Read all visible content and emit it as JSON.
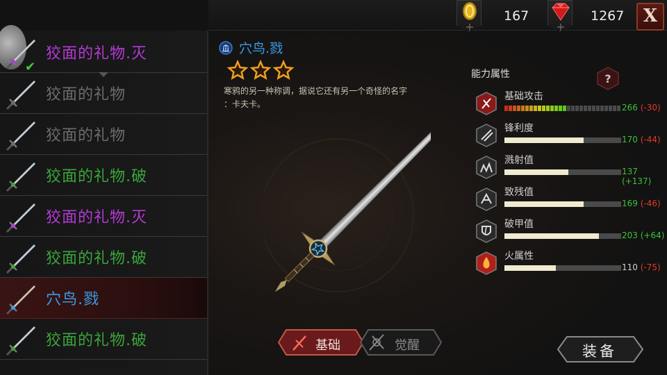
{
  "currency": {
    "gold": {
      "icon": "gold-coin-icon",
      "value": "167"
    },
    "gems": {
      "icon": "ruby-gem-icon",
      "value": "1267"
    },
    "close_label": "X"
  },
  "weapon_list": [
    {
      "name": "狡面的礼物.灭",
      "color": "#b43ad6",
      "state": "equipped"
    },
    {
      "name": "狡面的礼物",
      "color": "#6c6c6c",
      "state": "normal"
    },
    {
      "name": "狡面的礼物",
      "color": "#6c6c6c",
      "state": "normal"
    },
    {
      "name": "狡面的礼物.破",
      "color": "#3aa63a",
      "state": "normal"
    },
    {
      "name": "狡面的礼物.灭",
      "color": "#b43ad6",
      "state": "normal"
    },
    {
      "name": "狡面的礼物.破",
      "color": "#3aa63a",
      "state": "normal"
    },
    {
      "name": "穴鸟.戮",
      "color": "#3a9ce6",
      "state": "selected"
    },
    {
      "name": "狡面的礼物.破",
      "color": "#3aa63a",
      "state": "normal"
    }
  ],
  "detail": {
    "title": "穴鸟.戮",
    "stars": 3,
    "description_line1": "寒鸦的另一种称调，据说它还有另一个奇怪的名字",
    "description_line2": "：卡夫卡。"
  },
  "tabs": {
    "basic": "基础",
    "awaken": "觉醒",
    "active": "basic"
  },
  "equip_label": "装备",
  "stats": {
    "title": "能力属性",
    "items": [
      {
        "name": "基础攻击",
        "icon": "attack-icon",
        "value": "266",
        "delta": "(-30)",
        "delta_sign": "negative",
        "fill": 0.53
      },
      {
        "name": "锋利度",
        "icon": "sharpness-icon",
        "value": "170",
        "delta": "(-44)",
        "delta_sign": "negative",
        "fill": 0.68
      },
      {
        "name": "溅射值",
        "icon": "splash-icon",
        "value": "137",
        "delta": "(+137)",
        "delta_sign": "positive",
        "fill": 0.55
      },
      {
        "name": "致残值",
        "icon": "cripple-icon",
        "value": "169",
        "delta": "(-46)",
        "delta_sign": "negative",
        "fill": 0.68
      },
      {
        "name": "破甲值",
        "icon": "armor-break-icon",
        "value": "203",
        "delta": "(+64)",
        "delta_sign": "positive",
        "fill": 0.81
      },
      {
        "name": "火属性",
        "icon": "fire-icon",
        "value": "110",
        "delta": "(-75)",
        "delta_sign": "negative",
        "fill": 0.44
      }
    ]
  }
}
